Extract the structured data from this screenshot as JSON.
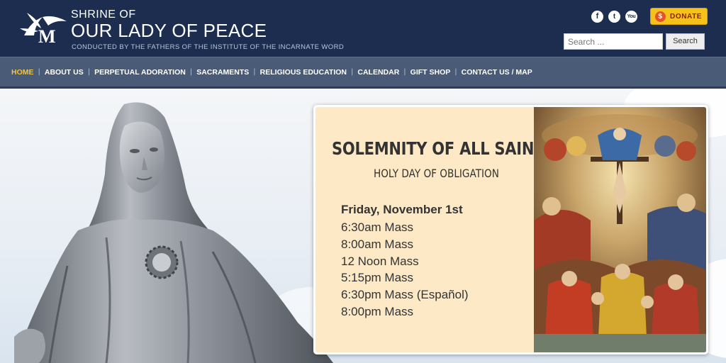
{
  "header": {
    "title_line1": "SHRINE OF",
    "title_line2": "OUR LADY OF PEACE",
    "tagline": "CONDUCTED BY THE FATHERS OF THE INSTITUTE OF THE INCARNATE WORD",
    "logo_letter": "M",
    "social": [
      {
        "name": "facebook-icon",
        "glyph": "f"
      },
      {
        "name": "twitter-icon",
        "glyph": "t"
      },
      {
        "name": "youtube-icon",
        "glyph": "You"
      }
    ],
    "donate_label": "DONATE",
    "donate_symbol": "$",
    "search_placeholder": "Search ...",
    "search_button": "Search"
  },
  "nav": {
    "items": [
      {
        "label": "HOME",
        "active": true
      },
      {
        "label": "ABOUT US"
      },
      {
        "label": "PERPETUAL ADORATION"
      },
      {
        "label": "SACRAMENTS"
      },
      {
        "label": "RELIGIOUS EDUCATION"
      },
      {
        "label": "CALENDAR"
      },
      {
        "label": "GIFT SHOP"
      },
      {
        "label": "CONTACT US / MAP"
      }
    ]
  },
  "banner": {
    "title": "SOLEMNITY OF ALL SAINTS",
    "subtitle": "HOLY DAY OF OBLIGATION",
    "day": "Friday, November 1st",
    "masses": [
      "6:30am Mass",
      "8:00am Mass",
      "12 Noon Mass",
      "5:15pm Mass",
      "6:30pm Mass (Español)",
      "8:00pm Mass"
    ]
  },
  "colors": {
    "header_bg": "#1c2d4f",
    "nav_bg": "#4a5b77",
    "nav_active": "#f3c53b",
    "donate_bg": "#f5c21b",
    "card_bg": "#fde9c6"
  }
}
